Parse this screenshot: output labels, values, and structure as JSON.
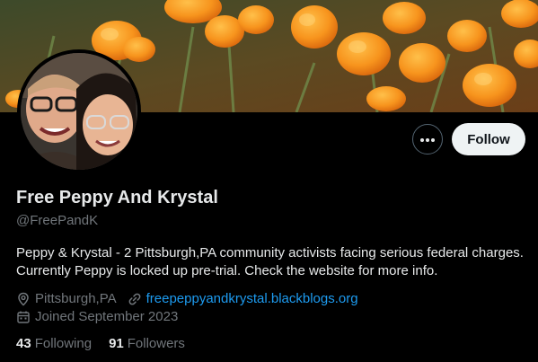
{
  "profile": {
    "name": "Free Peppy And Krystal",
    "handle": "@FreePandK",
    "bio": "Peppy & Krystal - 2 Pittsburgh,PA community activists facing serious federal charges. Currently Peppy is locked up pre-trial. Check the website for more info.",
    "location": "Pittsburgh,PA",
    "website": "freepeppyandkrystal.blackblogs.org",
    "joined": "Joined September 2023"
  },
  "actions": {
    "follow_label": "Follow",
    "more_label": "•••"
  },
  "stats": {
    "following_count": "43",
    "following_label": "Following",
    "followers_count": "91",
    "followers_label": "Followers"
  },
  "colors": {
    "background": "#000000",
    "primary_text": "#e7e9ea",
    "secondary_text": "#71767b",
    "link": "#1d9bf0",
    "follow_button_bg": "#eff3f4"
  },
  "icons": {
    "location": "location-pin-icon",
    "website": "link-icon",
    "joined": "calendar-icon",
    "more": "more-dots-icon"
  }
}
